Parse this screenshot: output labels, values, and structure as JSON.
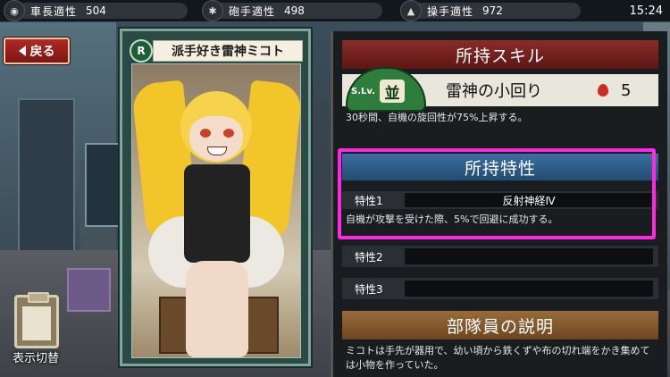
{
  "status_bar": {
    "stats": [
      {
        "label": "車長適性",
        "value": "504",
        "icon": "commander-icon"
      },
      {
        "label": "砲手適性",
        "value": "498",
        "icon": "gunner-icon"
      },
      {
        "label": "操手適性",
        "value": "972",
        "icon": "driver-icon"
      }
    ],
    "clock": "15:24"
  },
  "back_button": {
    "label": "戻る"
  },
  "toggle_display": {
    "label": "表示切替"
  },
  "card": {
    "rarity": "R",
    "name": "派手好き雷神ミコト"
  },
  "skill_section": {
    "header": "所持スキル",
    "badge_prefix": "S.Lv.",
    "badge_kanji": "並",
    "name": "雷神の小回り",
    "cost": "5",
    "description": "30秒間、自機の旋回性が75%上昇する。"
  },
  "trait_section": {
    "header": "所持特性",
    "traits": [
      {
        "label": "特性1",
        "value": "反射神経Ⅳ",
        "description": "自機が攻撃を受けた際、5%で回避に成功する。"
      },
      {
        "label": "特性2",
        "value": ""
      },
      {
        "label": "特性3",
        "value": ""
      }
    ]
  },
  "member_section": {
    "header": "部隊員の説明",
    "description": "ミコトは手先が器用で、幼い頃から鉄くずや布の切れ端をかき集めては小物を作っていた。"
  },
  "colors": {
    "highlight": "#ff29e0",
    "skill_header": "#8a2c2a",
    "trait_header": "#3b6fa0",
    "member_header": "#9a6b3b"
  }
}
